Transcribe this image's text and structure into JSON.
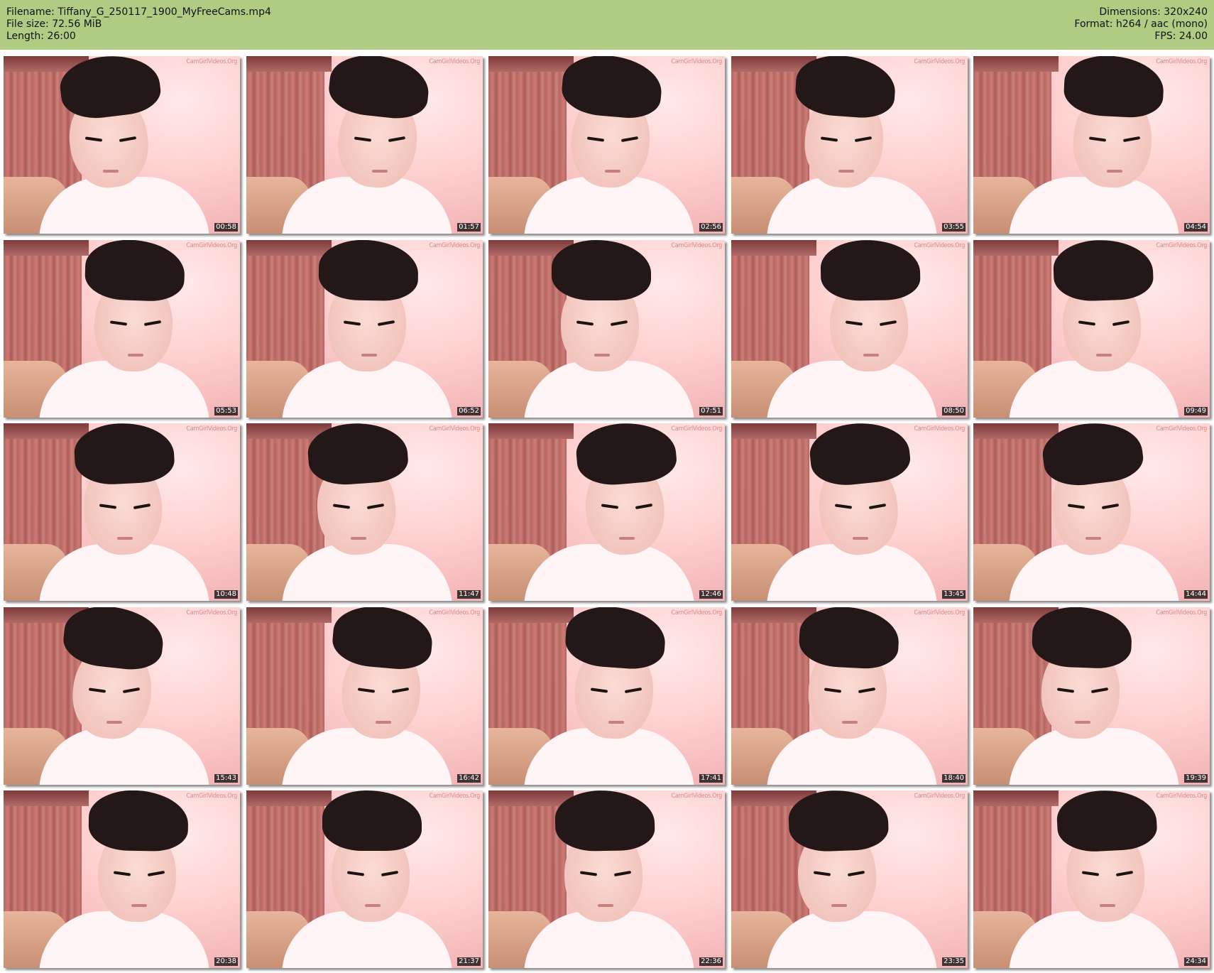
{
  "header": {
    "filename_label": "Filename:",
    "filename": "Tiffany_G_250117_1900_MyFreeCams.mp4",
    "filesize_label": "File size:",
    "filesize": "72.56 MiB",
    "length_label": "Length:",
    "length": "26:00",
    "dimensions_label": "Dimensions:",
    "dimensions": "320x240",
    "format_label": "Format:",
    "format": "h264 / aac (mono)",
    "fps_label": "FPS:",
    "fps": "24.00",
    "background_color": "#b0cc82"
  },
  "watermark": "CamGirlVideos.Org",
  "thumbnails": [
    {
      "time": "00:58"
    },
    {
      "time": "01:57"
    },
    {
      "time": "02:56"
    },
    {
      "time": "03:55"
    },
    {
      "time": "04:54"
    },
    {
      "time": "05:53"
    },
    {
      "time": "06:52"
    },
    {
      "time": "07:51"
    },
    {
      "time": "08:50"
    },
    {
      "time": "09:49"
    },
    {
      "time": "10:48"
    },
    {
      "time": "11:47"
    },
    {
      "time": "12:46"
    },
    {
      "time": "13:45"
    },
    {
      "time": "14:44"
    },
    {
      "time": "15:43"
    },
    {
      "time": "16:42"
    },
    {
      "time": "17:41"
    },
    {
      "time": "18:40"
    },
    {
      "time": "19:39"
    },
    {
      "time": "20:38"
    },
    {
      "time": "21:37"
    },
    {
      "time": "22:36"
    },
    {
      "time": "23:35"
    },
    {
      "time": "24:34"
    }
  ]
}
